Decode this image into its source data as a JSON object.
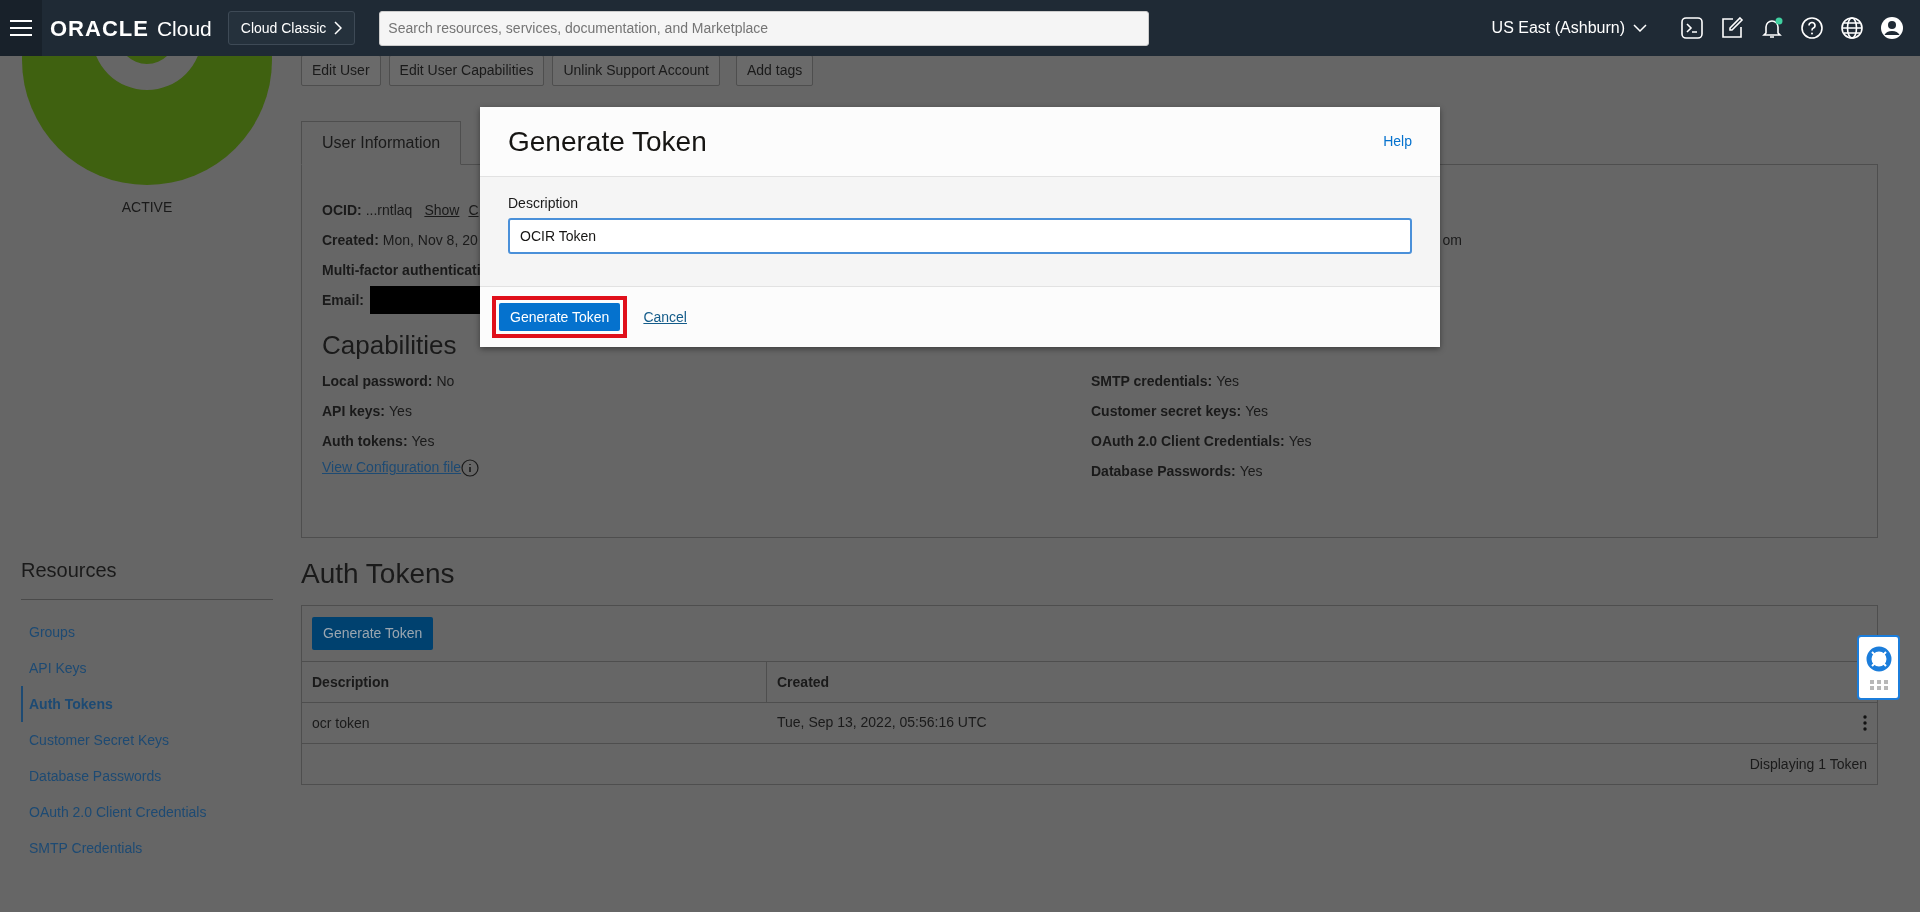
{
  "header": {
    "logo": "ORACLE",
    "product": "Cloud",
    "console_switch": "Cloud Classic",
    "search": {
      "placeholder": "Search resources, services, documentation, and Marketplace"
    },
    "region": "US East (Ashburn)"
  },
  "user_actions": [
    "Edit User",
    "Edit User Capabilities",
    "Unlink Support Account",
    "Add tags"
  ],
  "avatar_status": "ACTIVE",
  "tabs": [
    {
      "label": "User Information",
      "selected": true
    }
  ],
  "user_info": [
    {
      "label": "OCID:",
      "value": "...rntlaq",
      "links": [
        "Show",
        "C"
      ]
    },
    {
      "label": "Created:",
      "value": "Mon, Nov 8, 20",
      "tail": "om"
    },
    {
      "label": "Multi-factor authenticati"
    },
    {
      "label": "Email:",
      "redacted": true
    }
  ],
  "capabilities": {
    "title": "Capabilities",
    "left": [
      {
        "label": "Local password:",
        "value": "No"
      },
      {
        "label": "API keys:",
        "value": "Yes"
      },
      {
        "label": "Auth tokens:",
        "value": "Yes"
      }
    ],
    "config_link": "View Configuration file",
    "right": [
      {
        "label": "SMTP credentials:",
        "value": "Yes"
      },
      {
        "label": "Customer secret keys:",
        "value": "Yes"
      },
      {
        "label": "OAuth 2.0 Client Credentials:",
        "value": "Yes"
      },
      {
        "label": "Database Passwords:",
        "value": "Yes"
      }
    ]
  },
  "resources": {
    "title": "Resources",
    "items": [
      {
        "label": "Groups",
        "selected": false
      },
      {
        "label": "API Keys",
        "selected": false
      },
      {
        "label": "Auth Tokens",
        "selected": true
      },
      {
        "label": "Customer Secret Keys",
        "selected": false
      },
      {
        "label": "Database Passwords",
        "selected": false
      },
      {
        "label": "OAuth 2.0 Client Credentials",
        "selected": false
      },
      {
        "label": "SMTP Credentials",
        "selected": false
      }
    ]
  },
  "auth_tokens": {
    "title": "Auth Tokens",
    "button": "Generate Token",
    "columns": [
      "Description",
      "Created"
    ],
    "rows": [
      {
        "cells": [
          "ocr token",
          "Tue, Sep 13, 2022, 05:56:16 UTC"
        ]
      }
    ],
    "footer": "Displaying 1 Token"
  },
  "modal": {
    "title": "Generate Token",
    "help": "Help",
    "field": {
      "label": "Description",
      "value": "OCIR Token"
    },
    "primary": "Generate Token",
    "primary_highlighted": true,
    "cancel": "Cancel"
  }
}
